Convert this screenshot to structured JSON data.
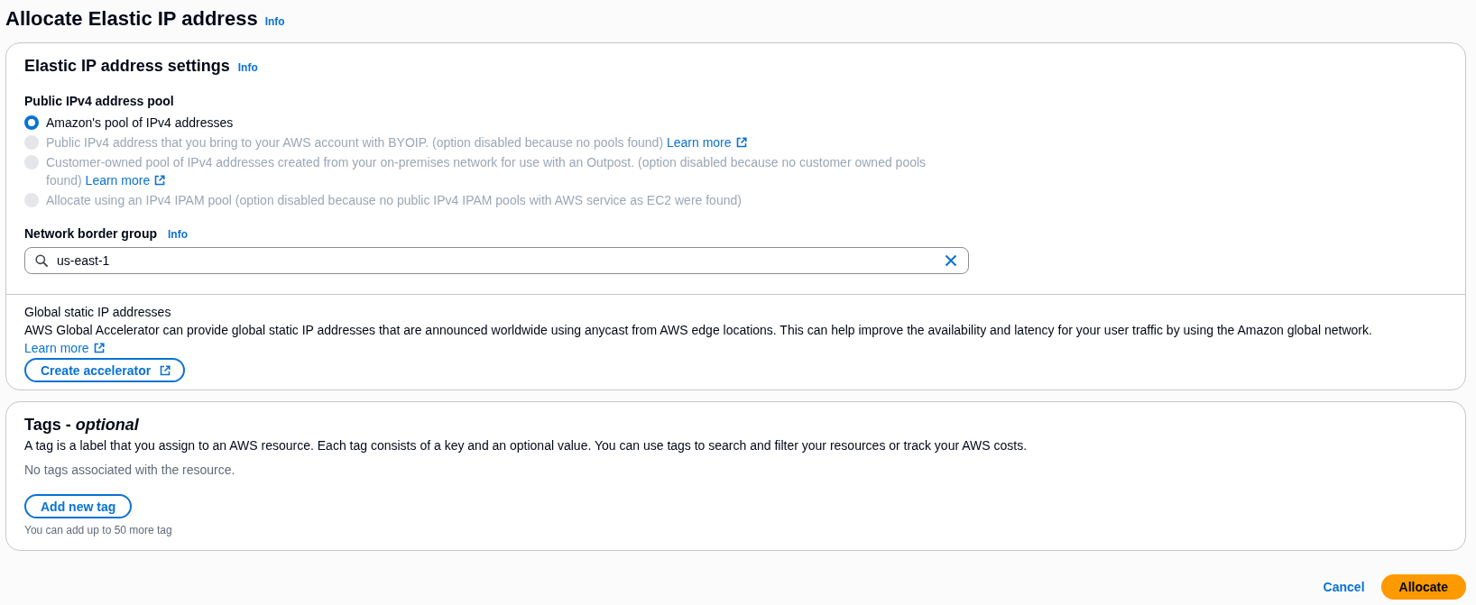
{
  "page": {
    "title": "Allocate Elastic IP address",
    "info_link": "Info"
  },
  "settings_panel": {
    "title": "Elastic IP address settings",
    "info_link": "Info",
    "address_pool": {
      "label": "Public IPv4 address pool",
      "options": [
        {
          "label": "Amazon's pool of IPv4 addresses",
          "selected": true,
          "disabled": false
        },
        {
          "label": "Public IPv4 address that you bring to your AWS account with BYOIP. (option disabled because no pools found)",
          "link": "Learn more",
          "selected": false,
          "disabled": true
        },
        {
          "label": "Customer-owned pool of IPv4 addresses created from your on-premises network for use with an Outpost. (option disabled because no customer owned pools found)",
          "link": "Learn more",
          "selected": false,
          "disabled": true
        },
        {
          "label": "Allocate using an IPv4 IPAM pool (option disabled because no public IPv4 IPAM pools with AWS service as EC2 were found)",
          "selected": false,
          "disabled": true
        }
      ]
    },
    "network_border_group": {
      "label": "Network border group",
      "info_link": "Info",
      "value": "us-east-1"
    },
    "global_static_ip": {
      "title": "Global static IP addresses",
      "description": "AWS Global Accelerator can provide global static IP addresses that are announced worldwide using anycast from AWS edge locations. This can help improve the availability and latency for your user traffic by using the Amazon global network.",
      "link": "Learn more",
      "button": "Create accelerator"
    }
  },
  "tags_panel": {
    "title": "Tags - *optional*",
    "description": "A tag is a label that you assign to an AWS resource. Each tag consists of a key and an optional value. You can use tags to search and filter your resources or track your AWS costs.",
    "empty_message": "No tags associated with the resource.",
    "button": "Add new tag",
    "hint": "You can add up to 50 more tag"
  },
  "footer": {
    "buttons": [
      {
        "label": "Cancel",
        "kind": "link"
      },
      {
        "label": "Allocate",
        "kind": "primary"
      }
    ]
  }
}
